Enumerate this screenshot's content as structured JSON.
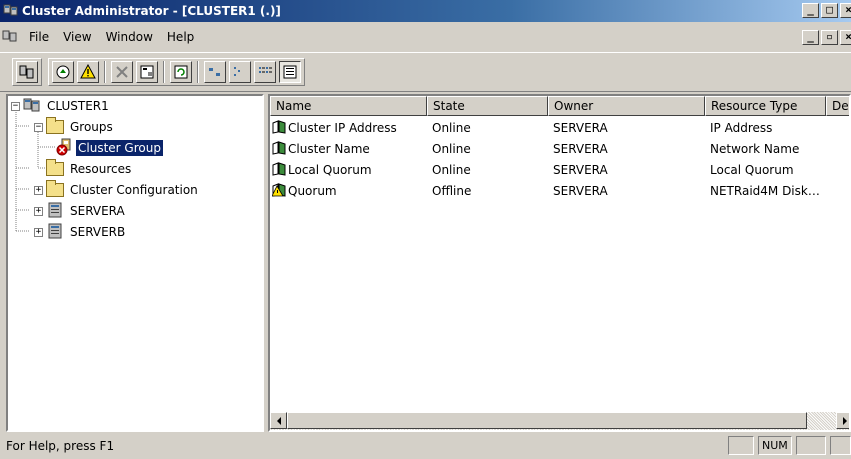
{
  "window": {
    "title": "Cluster Administrator - [CLUSTER1 (.)]",
    "app_icon": "cluster-app-icon",
    "buttons": {
      "minimize": "_",
      "maximize": "□",
      "close": "×"
    }
  },
  "menu": {
    "items": [
      "File",
      "View",
      "Window",
      "Help"
    ],
    "mdi_buttons": {
      "minimize": "_",
      "restore": "▫",
      "close": "×"
    }
  },
  "toolbar": {
    "buttons": [
      "open-connection",
      "bring-online",
      "take-offline",
      "delete",
      "properties",
      "refresh",
      "large-icons",
      "small-icons",
      "list",
      "details"
    ]
  },
  "tree": {
    "root": "CLUSTER1",
    "groups": "Groups",
    "cluster_group": "Cluster Group",
    "resources": "Resources",
    "cluster_configuration": "Cluster Configuration",
    "servera": "SERVERA",
    "serverb": "SERVERB",
    "expanded_marker": "−",
    "collapsed_marker": "+"
  },
  "list": {
    "columns": [
      "Name",
      "State",
      "Owner",
      "Resource Type",
      "De"
    ],
    "rows": [
      {
        "name": "Cluster IP Address",
        "state": "Online",
        "owner": "SERVERA",
        "type": "IP Address",
        "status": "online"
      },
      {
        "name": "Cluster Name",
        "state": "Online",
        "owner": "SERVERA",
        "type": "Network Name",
        "status": "online"
      },
      {
        "name": "Local Quorum",
        "state": "Online",
        "owner": "SERVERA",
        "type": "Local Quorum",
        "status": "online"
      },
      {
        "name": "Quorum",
        "state": "Offline",
        "owner": "SERVERA",
        "type": "NETRaid4M Disk…",
        "status": "offline"
      }
    ]
  },
  "statusbar": {
    "help_text": "For Help, press F1",
    "num": "NUM"
  },
  "colors": {
    "title_start": "#0a246a",
    "title_end": "#a6caf0",
    "selection": "#0a246a",
    "face": "#d4d0c8"
  }
}
